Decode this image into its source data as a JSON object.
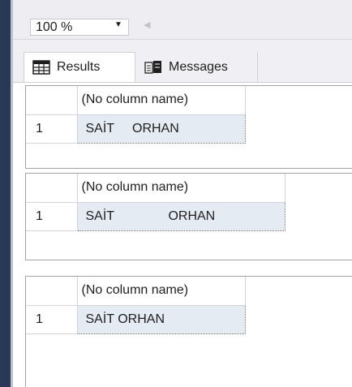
{
  "zoom": {
    "value": "100 %"
  },
  "tabs": [
    {
      "label": "Results",
      "icon": "grid-icon",
      "active": true
    },
    {
      "label": "Messages",
      "icon": "messages-icon",
      "active": false
    }
  ],
  "result_sets": [
    {
      "header": "(No column name)",
      "rows": [
        {
          "num": "1",
          "value": "SAİT     ORHAN"
        }
      ]
    },
    {
      "header": "(No column name)",
      "rows": [
        {
          "num": "1",
          "value": "SAİT               ORHAN"
        }
      ]
    },
    {
      "header": "(No column name)",
      "rows": [
        {
          "num": "1",
          "value": "SAİT ORHAN"
        }
      ]
    }
  ],
  "colors": {
    "left_bar": "#293955",
    "selection": "#e5ebf3"
  }
}
